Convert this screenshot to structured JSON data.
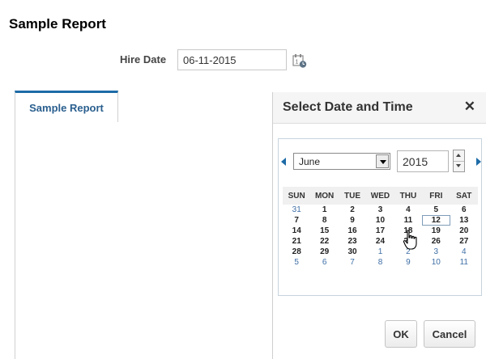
{
  "report_title": "Sample Report",
  "hire_date": {
    "label": "Hire Date",
    "value": "06-11-2015"
  },
  "tabs": [
    {
      "label": "Sample Report",
      "active": true
    }
  ],
  "date_picker": {
    "title": "Select Date and Time",
    "close_label": "✕",
    "month": "June",
    "year": "2015",
    "weekdays": [
      "SUN",
      "MON",
      "TUE",
      "WED",
      "THU",
      "FRI",
      "SAT"
    ],
    "weeks": [
      [
        {
          "d": "31",
          "other": true
        },
        {
          "d": "1"
        },
        {
          "d": "2"
        },
        {
          "d": "3"
        },
        {
          "d": "4"
        },
        {
          "d": "5"
        },
        {
          "d": "6"
        }
      ],
      [
        {
          "d": "7"
        },
        {
          "d": "8"
        },
        {
          "d": "9"
        },
        {
          "d": "10"
        },
        {
          "d": "11",
          "selected": true
        },
        {
          "d": "12",
          "today": true
        },
        {
          "d": "13"
        }
      ],
      [
        {
          "d": "14"
        },
        {
          "d": "15"
        },
        {
          "d": "16"
        },
        {
          "d": "17"
        },
        {
          "d": "18"
        },
        {
          "d": "19"
        },
        {
          "d": "20"
        }
      ],
      [
        {
          "d": "21"
        },
        {
          "d": "22"
        },
        {
          "d": "23"
        },
        {
          "d": "24"
        },
        {
          "d": "25"
        },
        {
          "d": "26"
        },
        {
          "d": "27"
        }
      ],
      [
        {
          "d": "28"
        },
        {
          "d": "29"
        },
        {
          "d": "30"
        },
        {
          "d": "1",
          "other": true
        },
        {
          "d": "2",
          "other": true
        },
        {
          "d": "3",
          "other": true
        },
        {
          "d": "4",
          "other": true
        }
      ],
      [
        {
          "d": "5",
          "other": true
        },
        {
          "d": "6",
          "other": true
        },
        {
          "d": "7",
          "other": true
        },
        {
          "d": "8",
          "other": true
        },
        {
          "d": "9",
          "other": true
        },
        {
          "d": "10",
          "other": true
        },
        {
          "d": "11",
          "other": true
        }
      ]
    ],
    "ok_label": "OK",
    "cancel_label": "Cancel"
  },
  "colors": {
    "accent": "#1d6ba7",
    "tab_text": "#2a5f8f",
    "other_month_day": "#3e6ea6"
  },
  "icons": {
    "calendar_trigger": "calendar-clock-icon",
    "prev_month": "arrow-left-icon",
    "next_month": "arrow-right-icon",
    "cursor": "hand-pointer-icon"
  }
}
